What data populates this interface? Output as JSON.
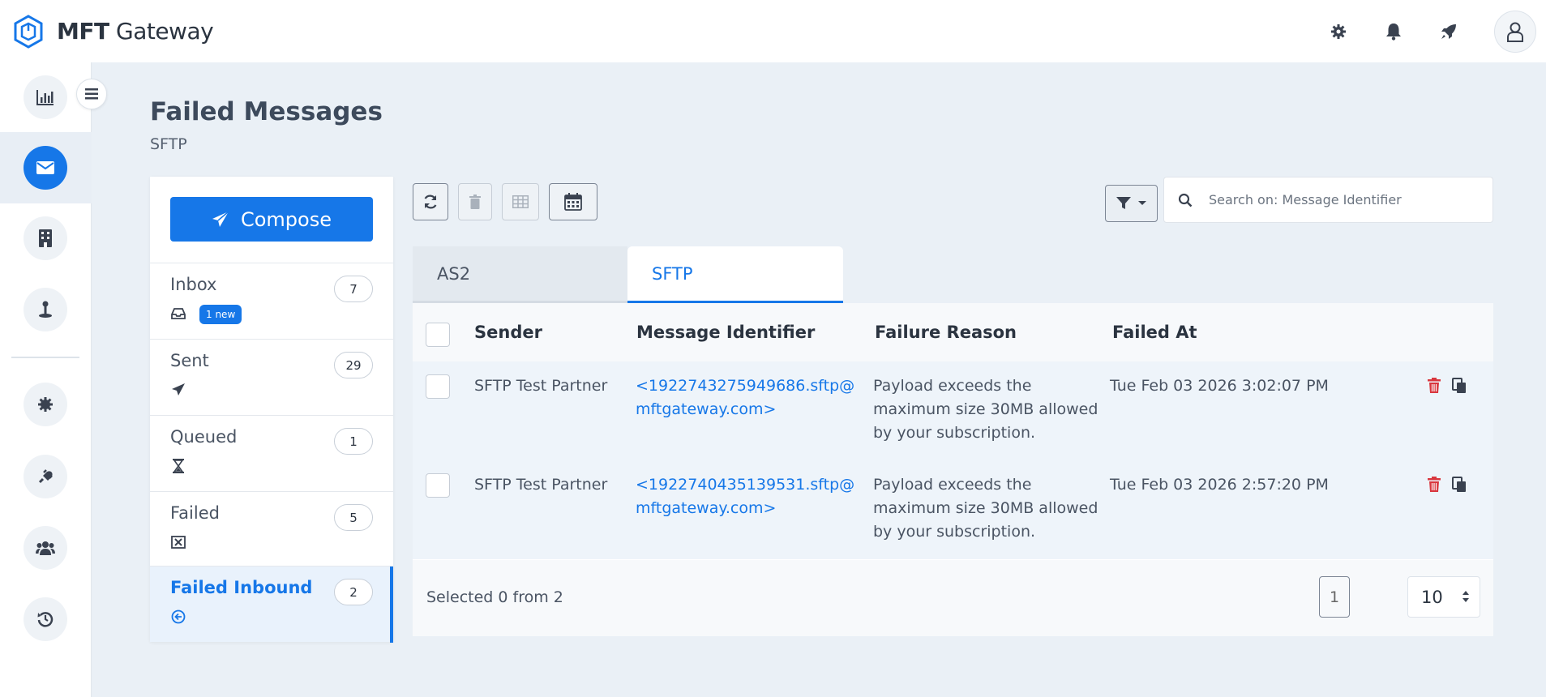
{
  "app": {
    "brand_bold": "MFT",
    "brand_rest": "Gateway"
  },
  "page": {
    "title": "Failed Messages",
    "subtitle": "SFTP"
  },
  "compose": {
    "label": "Compose"
  },
  "folders": [
    {
      "name": "Inbox",
      "count": "7",
      "badge": "1 new",
      "icon": "inbox-icon"
    },
    {
      "name": "Sent",
      "count": "29",
      "icon": "paper-plane-icon"
    },
    {
      "name": "Queued",
      "count": "1",
      "icon": "hourglass-icon"
    },
    {
      "name": "Failed",
      "count": "5",
      "icon": "x-square-icon"
    },
    {
      "name": "Failed Inbound",
      "count": "2",
      "icon": "circle-arrow-left-icon",
      "active": true
    }
  ],
  "search": {
    "placeholder": "Search on: Message Identifier",
    "value": ""
  },
  "tabs": [
    {
      "label": "AS2",
      "active": false
    },
    {
      "label": "SFTP",
      "active": true
    }
  ],
  "table": {
    "headers": {
      "sender": "Sender",
      "message_id": "Message Identifier",
      "reason": "Failure Reason",
      "failed_at": "Failed At"
    },
    "rows": [
      {
        "sender": "SFTP Test Partner",
        "message_id_1": "<1922743275949686.sftp@",
        "message_id_2": "mftgateway.com>",
        "reason_1": "Payload exceeds the",
        "reason_2": "maximum size 30MB allowed",
        "reason_3": "by your subscription.",
        "failed_at": "Tue Feb 03 2026 3:02:07 PM"
      },
      {
        "sender": "SFTP Test Partner",
        "message_id_1": "<1922740435139531.sftp@",
        "message_id_2": "mftgateway.com>",
        "reason_1": "Payload exceeds the",
        "reason_2": "maximum size 30MB allowed",
        "reason_3": "by your subscription.",
        "failed_at": "Tue Feb 03 2026 2:57:20 PM"
      }
    ],
    "footer": {
      "selected": "Selected 0 from 2",
      "page": "1",
      "per_page": "10"
    }
  },
  "colors": {
    "accent": "#1677e8",
    "danger": "#d9363e",
    "background": "#eaf0f6"
  }
}
